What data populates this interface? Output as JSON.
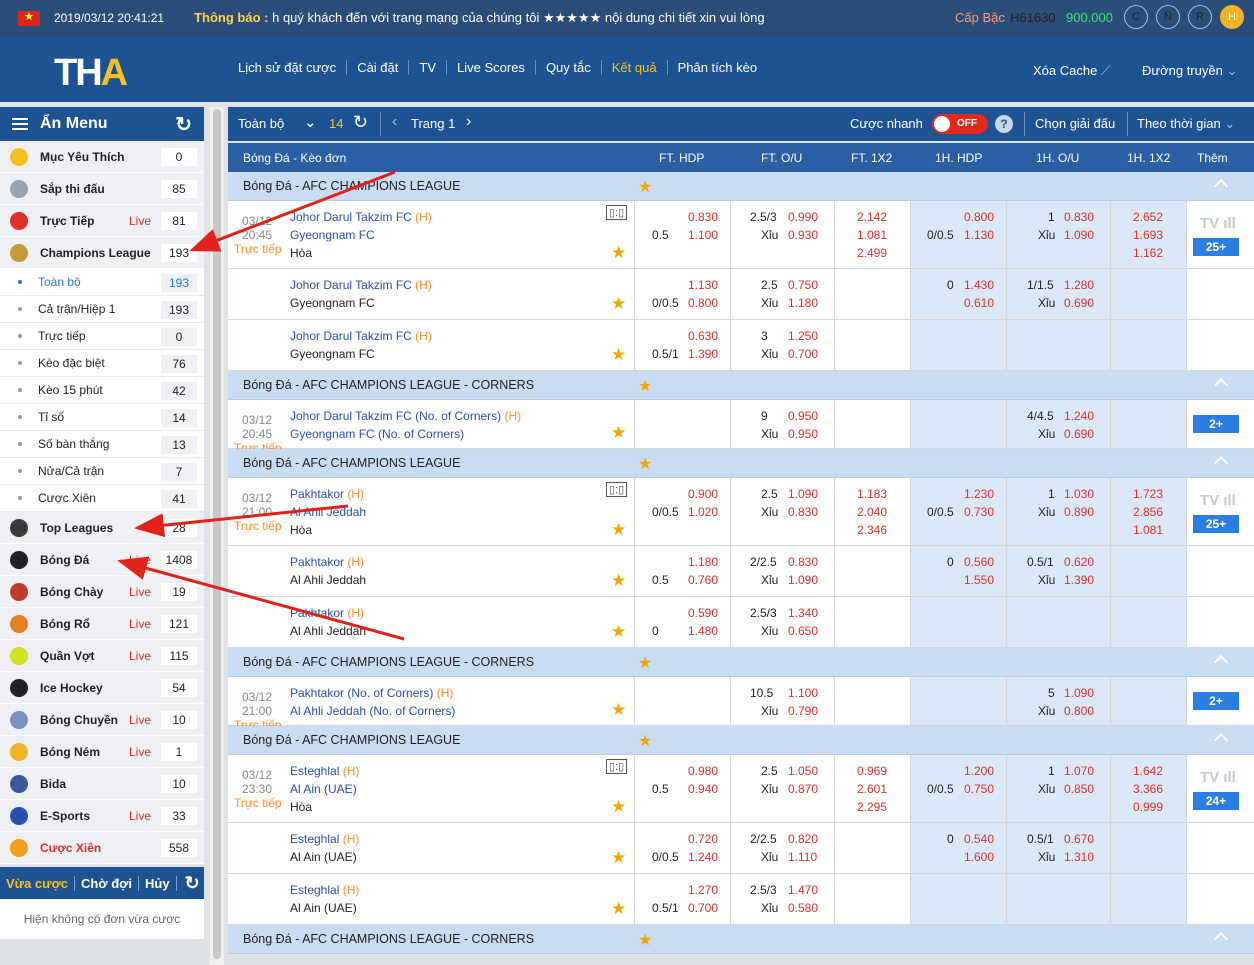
{
  "topbar": {
    "datetime": "2019/03/12 20:41:21",
    "notice_label": "Thông báo :",
    "notice_text": "h quý khách đến với trang mạng của chúng tôi ★★★★★ nội dung chi tiết xin vui lòng",
    "level_label": "Cấp Bậc",
    "user_id": "H61630",
    "balance": "900.000",
    "circles": [
      "C",
      "N",
      "R",
      "H"
    ]
  },
  "header": {
    "logo_t": "TH",
    "logo_a": "A",
    "nav": [
      "Lịch sử đặt cược",
      "Cài đặt",
      "TV",
      "Live Scores",
      "Quy tắc",
      "Kết quả",
      "Phân tích kèo"
    ],
    "clear_cache": "Xóa Cache",
    "stream": "Đường truyền"
  },
  "sidebar": {
    "title": "Ẩn Menu",
    "top_items": [
      {
        "label": "Mục Yêu Thích",
        "count": "0",
        "live": "",
        "color": "#f4c21f"
      },
      {
        "label": "Sắp thi đấu",
        "count": "85",
        "live": "",
        "color": "#9aa4b0"
      },
      {
        "label": "Trực Tiếp",
        "count": "81",
        "live": "Live",
        "color": "#e0302b"
      },
      {
        "label": "Champions League",
        "count": "193",
        "live": "",
        "color": "#c49a3a"
      }
    ],
    "sub_items": [
      {
        "label": "Toàn bộ",
        "count": "193"
      },
      {
        "label": "Cả trận/Hiệp 1",
        "count": "193"
      },
      {
        "label": "Trực tiếp",
        "count": "0"
      },
      {
        "label": "Kèo đặc biệt",
        "count": "76"
      },
      {
        "label": "Kèo 15 phút",
        "count": "42"
      },
      {
        "label": "Tỉ số",
        "count": "14"
      },
      {
        "label": "Số bàn thắng",
        "count": "13"
      },
      {
        "label": "Nửa/Cả trận",
        "count": "7"
      },
      {
        "label": "Cược Xiên",
        "count": "41"
      }
    ],
    "sports": [
      {
        "label": "Top Leagues",
        "count": "28",
        "live": "",
        "color": "#3a3a3a"
      },
      {
        "label": "Bóng Đá",
        "count": "1408",
        "live": "Live",
        "color": "#222"
      },
      {
        "label": "Bóng Chày",
        "count": "19",
        "live": "Live",
        "color": "#c0392b"
      },
      {
        "label": "Bóng Rổ",
        "count": "121",
        "live": "Live",
        "color": "#e67e22"
      },
      {
        "label": "Quần Vợt",
        "count": "115",
        "live": "Live",
        "color": "#d4e022"
      },
      {
        "label": "Ice Hockey",
        "count": "54",
        "live": "",
        "color": "#222"
      },
      {
        "label": "Bóng Chuyền",
        "count": "10",
        "live": "Live",
        "color": "#7b8fc0"
      },
      {
        "label": "Bóng Ném",
        "count": "1",
        "live": "Live",
        "color": "#f0b428"
      },
      {
        "label": "Bida",
        "count": "10",
        "live": "",
        "color": "#3b5998"
      },
      {
        "label": "E-Sports",
        "count": "33",
        "live": "Live",
        "color": "#2a4fb0"
      },
      {
        "label": "Cược Xiên",
        "count": "558",
        "live": "",
        "color": "#f0a020"
      }
    ],
    "tabs": [
      "Vừa cược",
      "Chờ đợi",
      "Hủy"
    ],
    "empty": "Hiện không có đơn vừa cược"
  },
  "toolbar": {
    "all": "Toàn bộ",
    "count": "14",
    "page": "Trang 1",
    "quick": "Cược nhanh",
    "toggle": "OFF",
    "help": "?",
    "league": "Chọn giải đấu",
    "sort": "Theo thời gian"
  },
  "columns": [
    "Bóng Đá - Kèo đơn",
    "FT. HDP",
    "FT. O/U",
    "FT. 1X2",
    "1H. HDP",
    "1H. O/U",
    "1H. 1X2",
    "Thêm"
  ],
  "leagues": [
    {
      "name": "Bóng Đá - AFC CHAMPIONS LEAGUE",
      "matches": [
        {
          "date": "03/12",
          "time": "20:45",
          "live": "Trực tiếp",
          "home": "Johor Darul Takzim FC",
          "away": "Gyeongnam FC",
          "draw": "Hòa",
          "more": "25+",
          "rows": [
            {
              "hdp_line": "0.5",
              "hdp1": "0.830",
              "hdp2": "1.100",
              "ou_line": "2.5/3",
              "ou1": "0.990",
              "ou2": "0.930",
              "x1": "2.142",
              "x2": "1.081",
              "x3": "2.499",
              "h_line": "0/0.5",
              "h1": "0.800",
              "h2": "1.130",
              "hou_line": "1",
              "hou1": "0.830",
              "hou2": "1.090",
              "hx1": "2.652",
              "hx2": "1.693",
              "hx3": "1.162"
            },
            {
              "hdp_line": "0/0.5",
              "hdp1": "1.130",
              "hdp2": "0.800",
              "ou_line": "2.5",
              "ou1": "0.750",
              "ou2": "1.180",
              "h_line": "0",
              "h1": "1.430",
              "h2": "0.610",
              "hou_line": "1/1.5",
              "hou1": "1.280",
              "hou2": "0.690"
            },
            {
              "hdp_line": "0.5/1",
              "hdp1": "0.630",
              "hdp2": "1.390",
              "ou_line": "3",
              "ou1": "1.250",
              "ou2": "0.700"
            }
          ]
        }
      ]
    },
    {
      "name": "Bóng Đá - AFC CHAMPIONS LEAGUE - CORNERS",
      "matches": [
        {
          "date": "03/12",
          "time": "20:45",
          "live": "Trực tiếp",
          "home": "Johor Darul Takzim FC (No. of Corners)",
          "away": "Gyeongnam FC (No. of Corners)",
          "more": "2+",
          "rows": [
            {
              "ou_line": "9",
              "ou1": "0.950",
              "ou2": "0.950",
              "hou_line": "4/4.5",
              "hou1": "1.240",
              "hou2": "0.690"
            }
          ]
        }
      ]
    },
    {
      "name": "Bóng Đá - AFC CHAMPIONS LEAGUE",
      "matches": [
        {
          "date": "03/12",
          "time": "21:00",
          "live": "Trực tiếp",
          "home": "Pakhtakor",
          "away": "Al Ahli Jeddah",
          "draw": "Hòa",
          "more": "25+",
          "rows": [
            {
              "hdp_line": "0/0.5",
              "hdp1": "0.900",
              "hdp2": "1.020",
              "ou_line": "2.5",
              "ou1": "1.090",
              "ou2": "0.830",
              "x1": "1.183",
              "x2": "2.040",
              "x3": "2.346",
              "h_line": "0/0.5",
              "h1": "1.230",
              "h2": "0.730",
              "hou_line": "1",
              "hou1": "1.030",
              "hou2": "0.890",
              "hx1": "1.723",
              "hx2": "2.856",
              "hx3": "1.081"
            },
            {
              "hdp_line": "0.5",
              "hdp1": "1.180",
              "hdp2": "0.760",
              "ou_line": "2/2.5",
              "ou1": "0.830",
              "ou2": "1.090",
              "h_line": "0",
              "h1": "0.560",
              "h2": "1.550",
              "hou_line": "0.5/1",
              "hou1": "0.620",
              "hou2": "1.390"
            },
            {
              "hdp_line": "0",
              "hdp1": "0.590",
              "hdp2": "1.480",
              "ou_line": "2.5/3",
              "ou1": "1.340",
              "ou2": "0.650"
            }
          ]
        }
      ]
    },
    {
      "name": "Bóng Đá - AFC CHAMPIONS LEAGUE - CORNERS",
      "matches": [
        {
          "date": "03/12",
          "time": "21:00",
          "live": "Trực tiếp",
          "home": "Pakhtakor (No. of Corners)",
          "away": "Al Ahli Jeddah (No. of Corners)",
          "more": "2+",
          "rows": [
            {
              "ou_line": "10.5",
              "ou1": "1.100",
              "ou2": "0.790",
              "hou_line": "5",
              "hou1": "1.090",
              "hou2": "0.800"
            }
          ]
        }
      ]
    },
    {
      "name": "Bóng Đá - AFC CHAMPIONS LEAGUE",
      "matches": [
        {
          "date": "03/12",
          "time": "23:30",
          "live": "Trực tiếp",
          "home": "Esteghlal",
          "away": "Al Ain (UAE)",
          "draw": "Hòa",
          "more": "24+",
          "rows": [
            {
              "hdp_line": "0.5",
              "hdp1": "0.980",
              "hdp2": "0.940",
              "ou_line": "2.5",
              "ou1": "1.050",
              "ou2": "0.870",
              "x1": "0.969",
              "x2": "2.601",
              "x3": "2.295",
              "h_line": "0/0.5",
              "h1": "1.200",
              "h2": "0.750",
              "hou_line": "1",
              "hou1": "1.070",
              "hou2": "0.850",
              "hx1": "1.642",
              "hx2": "3.366",
              "hx3": "0.999"
            },
            {
              "hdp_line": "0/0.5",
              "hdp1": "0.720",
              "hdp2": "1.240",
              "ou_line": "2/2.5",
              "ou1": "0.820",
              "ou2": "1.110",
              "h_line": "0",
              "h1": "0.540",
              "h2": "1.600",
              "hou_line": "0.5/1",
              "hou1": "0.670",
              "hou2": "1.310"
            },
            {
              "hdp_line": "0.5/1",
              "hdp1": "1.270",
              "hdp2": "0.700",
              "ou_line": "2.5/3",
              "ou1": "1.470",
              "ou2": "0.580"
            }
          ]
        }
      ]
    },
    {
      "name": "Bóng Đá - AFC CHAMPIONS LEAGUE - CORNERS",
      "matches": []
    }
  ],
  "home_mark": "(H)",
  "xiu": "Xỉu",
  "tv": "TV"
}
